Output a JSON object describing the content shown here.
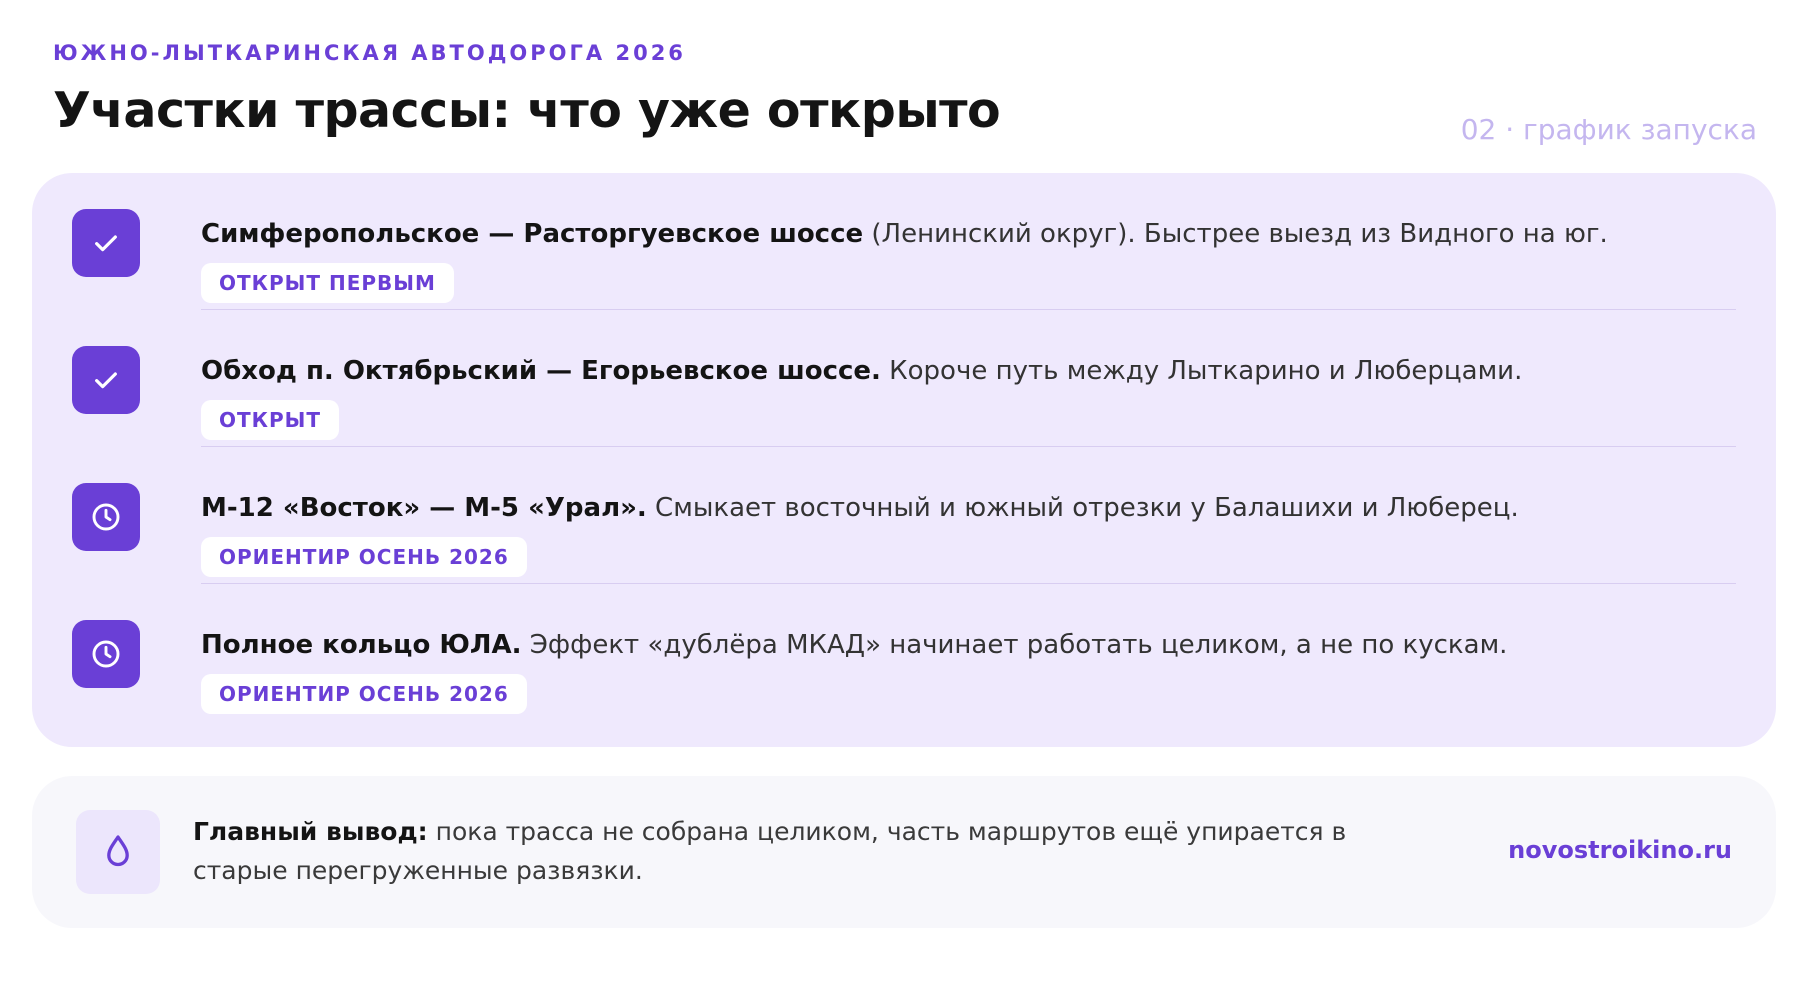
{
  "header": {
    "eyebrow": "ЮЖНО-ЛЫТКАРИНСКАЯ АВТОДОРОГА 2026",
    "title": "Участки трассы: что уже открыто",
    "page_tag": "02 · график запуска"
  },
  "sections": [
    {
      "icon": "check-icon",
      "bold": "Симферопольское — Расторгуевское шоссе",
      "text": " (Ленинский округ). Быстрее выезд из Видного на юг.",
      "badge": "ОТКРЫТ ПЕРВЫМ"
    },
    {
      "icon": "check-icon",
      "bold": "Обход п. Октябрьский — Егорьевское шоссе.",
      "text": " Короче путь между Лыткарино и Люберцами.",
      "badge": "ОТКРЫТ"
    },
    {
      "icon": "clock-icon",
      "bold": "М-12 «Восток» — М-5 «Урал».",
      "text": " Смыкает восточный и южный отрезки у Балашихи и Люберец.",
      "badge": "ОРИЕНТИР ОСЕНЬ 2026"
    },
    {
      "icon": "clock-icon",
      "bold": "Полное кольцо ЮЛА.",
      "text": " Эффект «дублёра МКАД» начинает работать целиком, а не по кускам.",
      "badge": "ОРИЕНТИР ОСЕНЬ 2026"
    }
  ],
  "summary": {
    "icon": "drop-icon",
    "bold": "Главный вывод:",
    "text": " пока трасса не собрана целиком, часть маршрутов ещё упирается в старые перегруженные развязки.",
    "brand": "novostroikino.ru"
  },
  "colors": {
    "accent": "#6a3fd6",
    "card_bg": "#efe9fd",
    "summary_bg": "#f7f7fb",
    "page_tag": "#c4b6ef"
  }
}
